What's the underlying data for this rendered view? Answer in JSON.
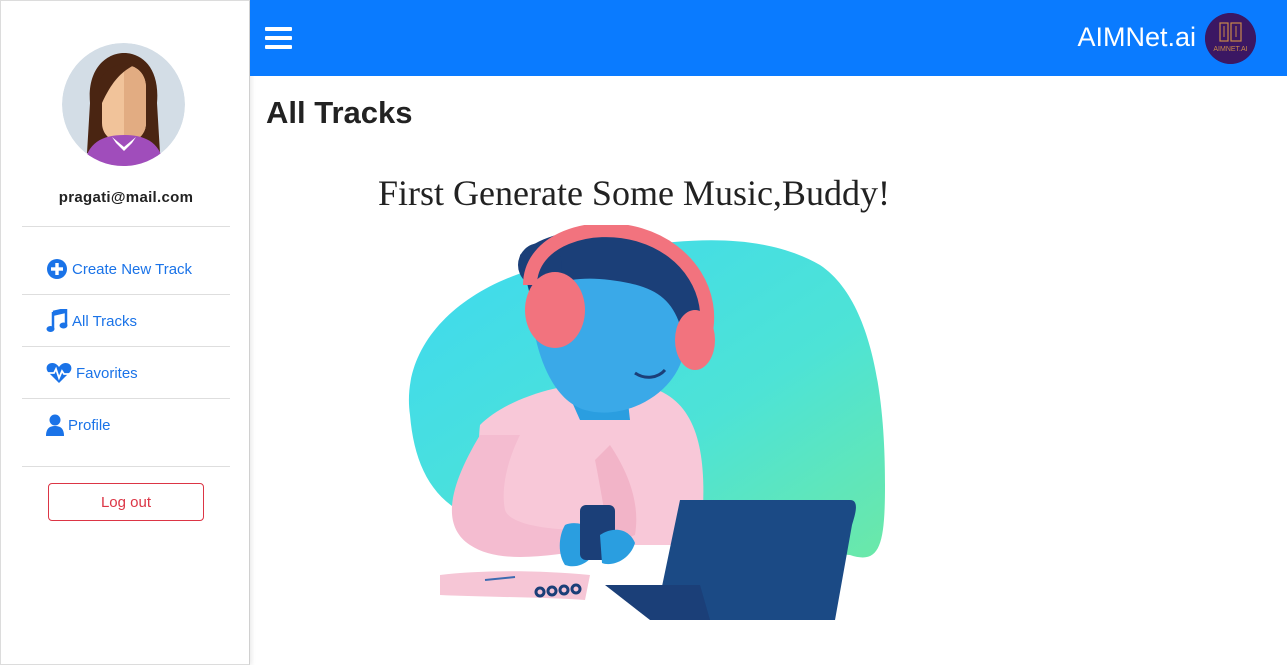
{
  "sidebar": {
    "user_email": "pragati@mail.com",
    "items": [
      {
        "label": "Create New Track",
        "icon": "plus-circle-icon"
      },
      {
        "label": "All Tracks",
        "icon": "music-note-icon"
      },
      {
        "label": "Favorites",
        "icon": "heartbeat-icon"
      },
      {
        "label": "Profile",
        "icon": "user-icon"
      }
    ],
    "logout_label": "Log out"
  },
  "header": {
    "brand": "AIMNet.ai",
    "logo_text": "AIMNET.AI",
    "accent_color": "#0a7bff"
  },
  "main": {
    "title": "All Tracks",
    "empty_message": "First Generate Some Music,Buddy!"
  }
}
